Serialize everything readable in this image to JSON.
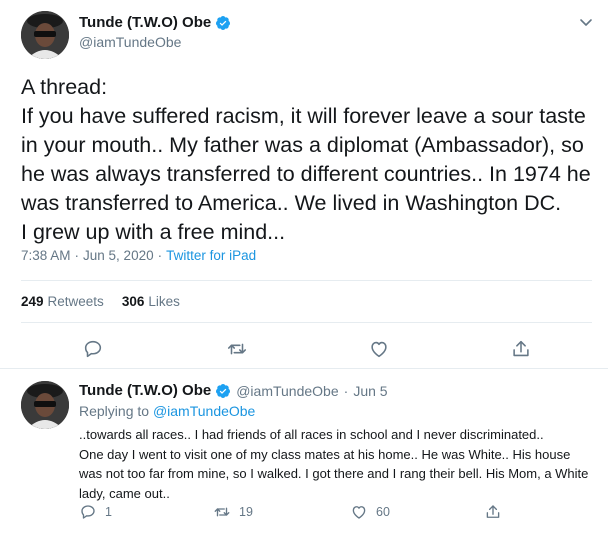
{
  "main_tweet": {
    "author_name": "Tunde (T.W.O) Obe",
    "handle": "@iamTundeObe",
    "text": "A thread:\nIf you have suffered racism, it will forever leave a sour taste in your mouth.. My father was a diplomat (Ambassador), so he was always transferred to different countries.. In 1974 he was transferred to America.. We lived in Washington DC.\nI grew up with a free mind...",
    "time": "7:38 AM",
    "date": "Jun 5, 2020",
    "separator": "·",
    "source": "Twitter for iPad",
    "retweets_count": "249",
    "retweets_label": "Retweets",
    "likes_count": "306",
    "likes_label": "Likes"
  },
  "reply_tweet": {
    "author_name": "Tunde (T.W.O) Obe",
    "handle": "@iamTundeObe",
    "separator": "·",
    "date": "Jun 5",
    "replying_label": "Replying to",
    "replying_to": "@iamTundeObe",
    "text": "..towards all races.. I had friends of all races in school and I never discriminated..\nOne day I went to visit one of my class mates at his home.. He was White.. His house was not too far from mine, so I walked. I got there and I rang their bell. His Mom, a White lady, came out..",
    "reply_count": "1",
    "retweet_count": "19",
    "like_count": "60"
  },
  "colors": {
    "accent": "#1da1f2",
    "link": "#1b95e0",
    "muted": "#657786",
    "text": "#14171a",
    "border": "#e6ecf0"
  },
  "icons": [
    "verified-badge-icon",
    "chevron-down-icon",
    "reply-icon",
    "retweet-icon",
    "like-icon",
    "share-icon"
  ]
}
